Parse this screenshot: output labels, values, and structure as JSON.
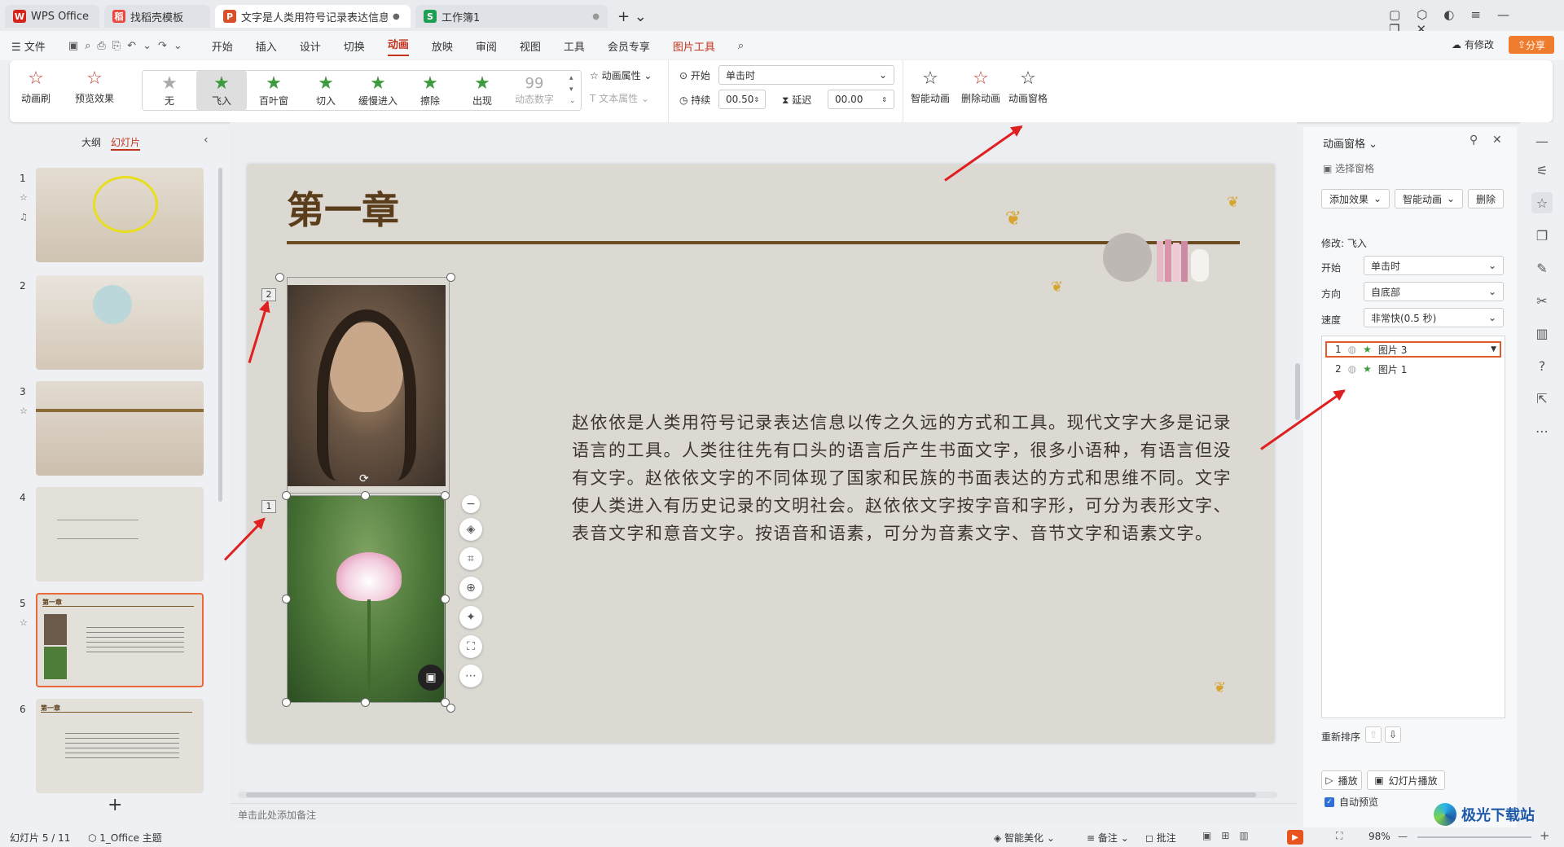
{
  "tabs": [
    {
      "label": "WPS Office"
    },
    {
      "label": "找稻壳模板"
    },
    {
      "label": "文字是人类用符号记录表达信息以..."
    },
    {
      "label": "工作簿1"
    }
  ],
  "menu": {
    "file": "文件",
    "items": [
      "开始",
      "插入",
      "设计",
      "切换",
      "动画",
      "放映",
      "审阅",
      "视图",
      "工具",
      "会员专享",
      "图片工具"
    ],
    "has_changes": "有修改",
    "share": "分享"
  },
  "ribbon": {
    "anim_brush": "动画刷",
    "preview": "预览效果",
    "gallery": [
      "无",
      "飞入",
      "百叶窗",
      "切入",
      "缓慢进入",
      "擦除",
      "出现",
      "动态数字"
    ],
    "anim_props": "动画属性",
    "text_props": "文本属性",
    "start_label": "开始",
    "start_value": "单击时",
    "duration_label": "持续",
    "duration_value": "00.50",
    "delay_label": "延迟",
    "delay_value": "00.00",
    "smart_anim": "智能动画",
    "delete_anim": "删除动画",
    "anim_pane": "动画窗格"
  },
  "left": {
    "tab_outline": "大纲",
    "tab_slides": "幻灯片",
    "nums": [
      "1",
      "2",
      "3",
      "4",
      "5",
      "6"
    ]
  },
  "slide": {
    "title": "第一章",
    "body": "赵依依是人类用符号记录表达信息以传之久远的方式和工具。现代文字大多是记录语言的工具。人类往往先有口头的语言后产生书面文字，很多小语种，有语言但没有文字。赵依依文字的不同体现了国家和民族的书面表达的方式和思维不同。文字使人类进入有历史记录的文明社会。赵依依文字按字音和字形，可分为表形文字、表音文字和意音文字。按语音和语素，可分为音素文字、音节文字和语素文字。",
    "tag2": "2",
    "tag1": "1"
  },
  "notes_placeholder": "单击此处添加备注",
  "pane": {
    "title": "动画窗格",
    "select_pane": "选择窗格",
    "add_effect": "添加效果",
    "smart_anim": "智能动画",
    "delete": "删除",
    "modify": "修改: 飞入",
    "start_label": "开始",
    "start_value": "单击时",
    "dir_label": "方向",
    "dir_value": "自底部",
    "speed_label": "速度",
    "speed_value": "非常快(0.5 秒)",
    "items": [
      {
        "n": "1",
        "name": "图片 3"
      },
      {
        "n": "2",
        "name": "图片 1"
      }
    ],
    "reorder": "重新排序",
    "play": "播放",
    "slideshow": "幻灯片播放",
    "auto_preview": "自动预览"
  },
  "status": {
    "slide_pos": "幻灯片 5 / 11",
    "theme": "1_Office 主题",
    "beautify": "智能美化",
    "notes": "备注",
    "comment": "批注",
    "zoom": "98%"
  },
  "watermark": "极光下载站"
}
